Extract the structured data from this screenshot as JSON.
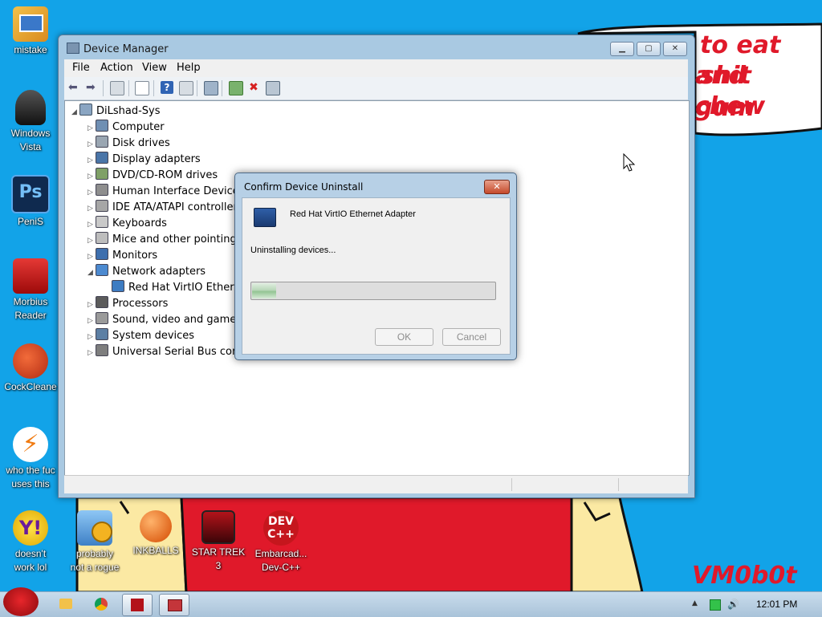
{
  "desktop": {
    "icons": [
      {
        "label_1": "mistake",
        "label_2": "",
        "icon": "monitor-folder-icon"
      },
      {
        "label_1": "Windows",
        "label_2": "Vista",
        "icon": "trash-bin-icon"
      },
      {
        "label_1": "PeniS",
        "label_2": "",
        "icon": "photoshop-icon"
      },
      {
        "label_1": "Morbius",
        "label_2": "Reader",
        "icon": "pdf-reader-icon"
      },
      {
        "label_1": "CockCleane",
        "label_2": "",
        "icon": "ccleaner-icon"
      },
      {
        "label_1": "who the fuc",
        "label_2": "uses this",
        "icon": "lightning-icon"
      },
      {
        "label_1": "doesn't",
        "label_2": "work lol",
        "icon": "yahoo-messenger-icon"
      },
      {
        "label_1": "probably",
        "label_2": "not a rogue",
        "icon": "gears-monitor-icon"
      },
      {
        "label_1": "INKBALLS",
        "label_2": "",
        "icon": "inkball-icon"
      },
      {
        "label_1": "STAR TREK",
        "label_2": "3",
        "icon": "star-trek-icon"
      },
      {
        "label_1": "Embarcad...",
        "label_2": "Dev-C++",
        "icon": "dev-cpp-icon"
      }
    ],
    "dev_icon_text": "DEV\nC++",
    "wallpaper": {
      "line1": "to eat shit",
      "line2": "and chew",
      "line3": "gum",
      "signature": "VM0b0t"
    }
  },
  "device_manager": {
    "title": "Device Manager",
    "menu": [
      "File",
      "Action",
      "View",
      "Help"
    ],
    "tree": {
      "root": "DiLshad-Sys",
      "nodes": [
        {
          "label": "Computer",
          "expanded": false,
          "icon": "computer-icon"
        },
        {
          "label": "Disk drives",
          "expanded": false,
          "icon": "disk-drive-icon"
        },
        {
          "label": "Display adapters",
          "expanded": false,
          "icon": "display-adapter-icon"
        },
        {
          "label": "DVD/CD-ROM drives",
          "expanded": false,
          "icon": "dvd-drive-icon"
        },
        {
          "label": "Human Interface Devices",
          "expanded": false,
          "icon": "hid-icon"
        },
        {
          "label": "IDE ATA/ATAPI controllers",
          "expanded": false,
          "icon": "ide-controller-icon"
        },
        {
          "label": "Keyboards",
          "expanded": false,
          "icon": "keyboard-icon"
        },
        {
          "label": "Mice and other pointing d",
          "expanded": false,
          "icon": "mouse-icon"
        },
        {
          "label": "Monitors",
          "expanded": false,
          "icon": "monitor-icon"
        },
        {
          "label": "Network adapters",
          "expanded": true,
          "icon": "network-adapter-icon"
        },
        {
          "label": "Red Hat VirtIO Etherne",
          "child": true,
          "icon": "network-card-icon"
        },
        {
          "label": "Processors",
          "expanded": false,
          "icon": "processor-icon"
        },
        {
          "label": "Sound, video and game c",
          "expanded": false,
          "icon": "speaker-icon"
        },
        {
          "label": "System devices",
          "expanded": false,
          "icon": "system-devices-icon"
        },
        {
          "label": "Universal Serial Bus contr",
          "expanded": false,
          "icon": "usb-icon"
        }
      ]
    }
  },
  "dialog": {
    "title": "Confirm Device Uninstall",
    "device_name": "Red Hat VirtIO Ethernet Adapter",
    "status": "Uninstalling devices...",
    "progress": 0.1,
    "ok_label": "OK",
    "cancel_label": "Cancel",
    "close_label": "✕"
  },
  "taskbar": {
    "clock": "12:01 PM"
  },
  "colors": {
    "desktop_bg": "#12a3e8",
    "wallpaper_red": "#e0192a",
    "wallpaper_yellow": "#fbe9a3"
  }
}
